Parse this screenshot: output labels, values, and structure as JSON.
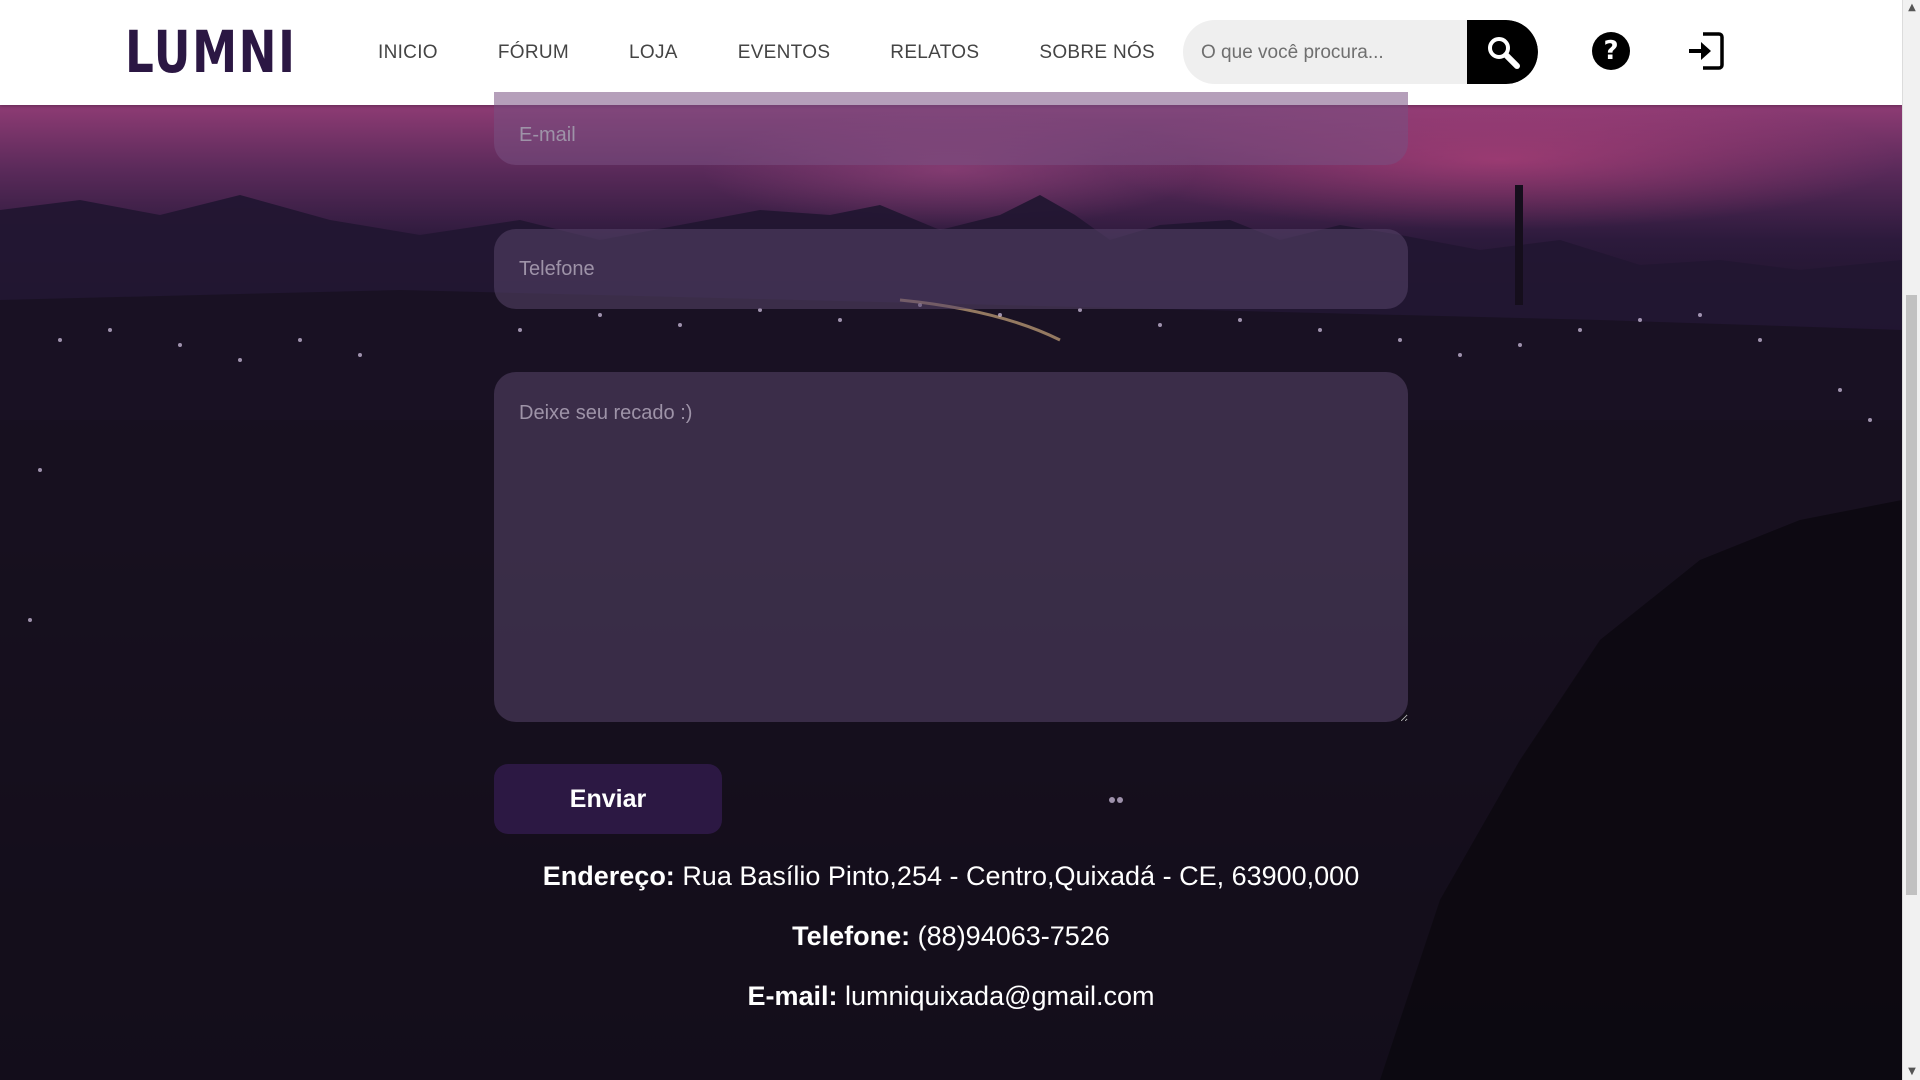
{
  "header": {
    "logo_text": "LUMNI",
    "nav": [
      {
        "label": "INICIO"
      },
      {
        "label": "FÓRUM"
      },
      {
        "label": "LOJA"
      },
      {
        "label": "EVENTOS"
      },
      {
        "label": "RELATOS"
      },
      {
        "label": "SOBRE NÓS"
      }
    ],
    "search": {
      "placeholder": "O que você procura...",
      "icon": "search-icon"
    },
    "help": {
      "icon": "question-circle-icon",
      "glyph": "?"
    },
    "login": {
      "icon": "sign-in-icon"
    }
  },
  "form": {
    "email_placeholder": "E-mail",
    "phone_placeholder": "Telefone",
    "message_placeholder": "Deixe seu recado :)",
    "submit_label": "Enviar"
  },
  "contact": {
    "address_label": "Endereço:",
    "address_value": "Rua Basílio Pinto,254 - Centro,Quixadá - CE, 63900,000",
    "phone_label": "Telefone:",
    "phone_value": "(88)94063-7526",
    "email_label": "E-mail:",
    "email_value": "lumniquixada@gmail.com"
  },
  "colors": {
    "brand": "#2b1743",
    "button": "#2c1843",
    "header_bg": "#ffffff",
    "nav_text": "#444444",
    "search_bg": "#efefef"
  }
}
